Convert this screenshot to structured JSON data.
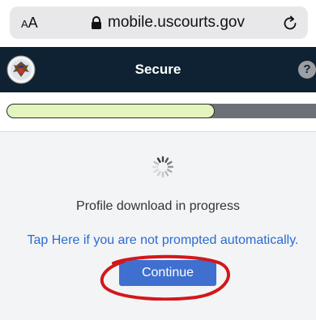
{
  "browser": {
    "text_size_small": "A",
    "text_size_large": "A",
    "domain": "mobile.uscourts.gov"
  },
  "header": {
    "title": "Secure",
    "help_label": "?"
  },
  "progress": {
    "fraction": 0.65
  },
  "main": {
    "status_message": "Profile download in progress",
    "prompt_link": "Tap Here if you are not prompted automatically.",
    "continue_label": "Continue"
  },
  "colors": {
    "header_bg": "#0f2233",
    "progress_fill": "#e4f4bd",
    "link": "#2a6bd1",
    "button": "#3f6fcf",
    "annotation": "#d3171b"
  },
  "icons": {
    "lock": "lock-icon",
    "reload": "reload-icon",
    "seal": "court-seal-icon",
    "help": "help-icon",
    "spinner": "loading-spinner-icon"
  }
}
